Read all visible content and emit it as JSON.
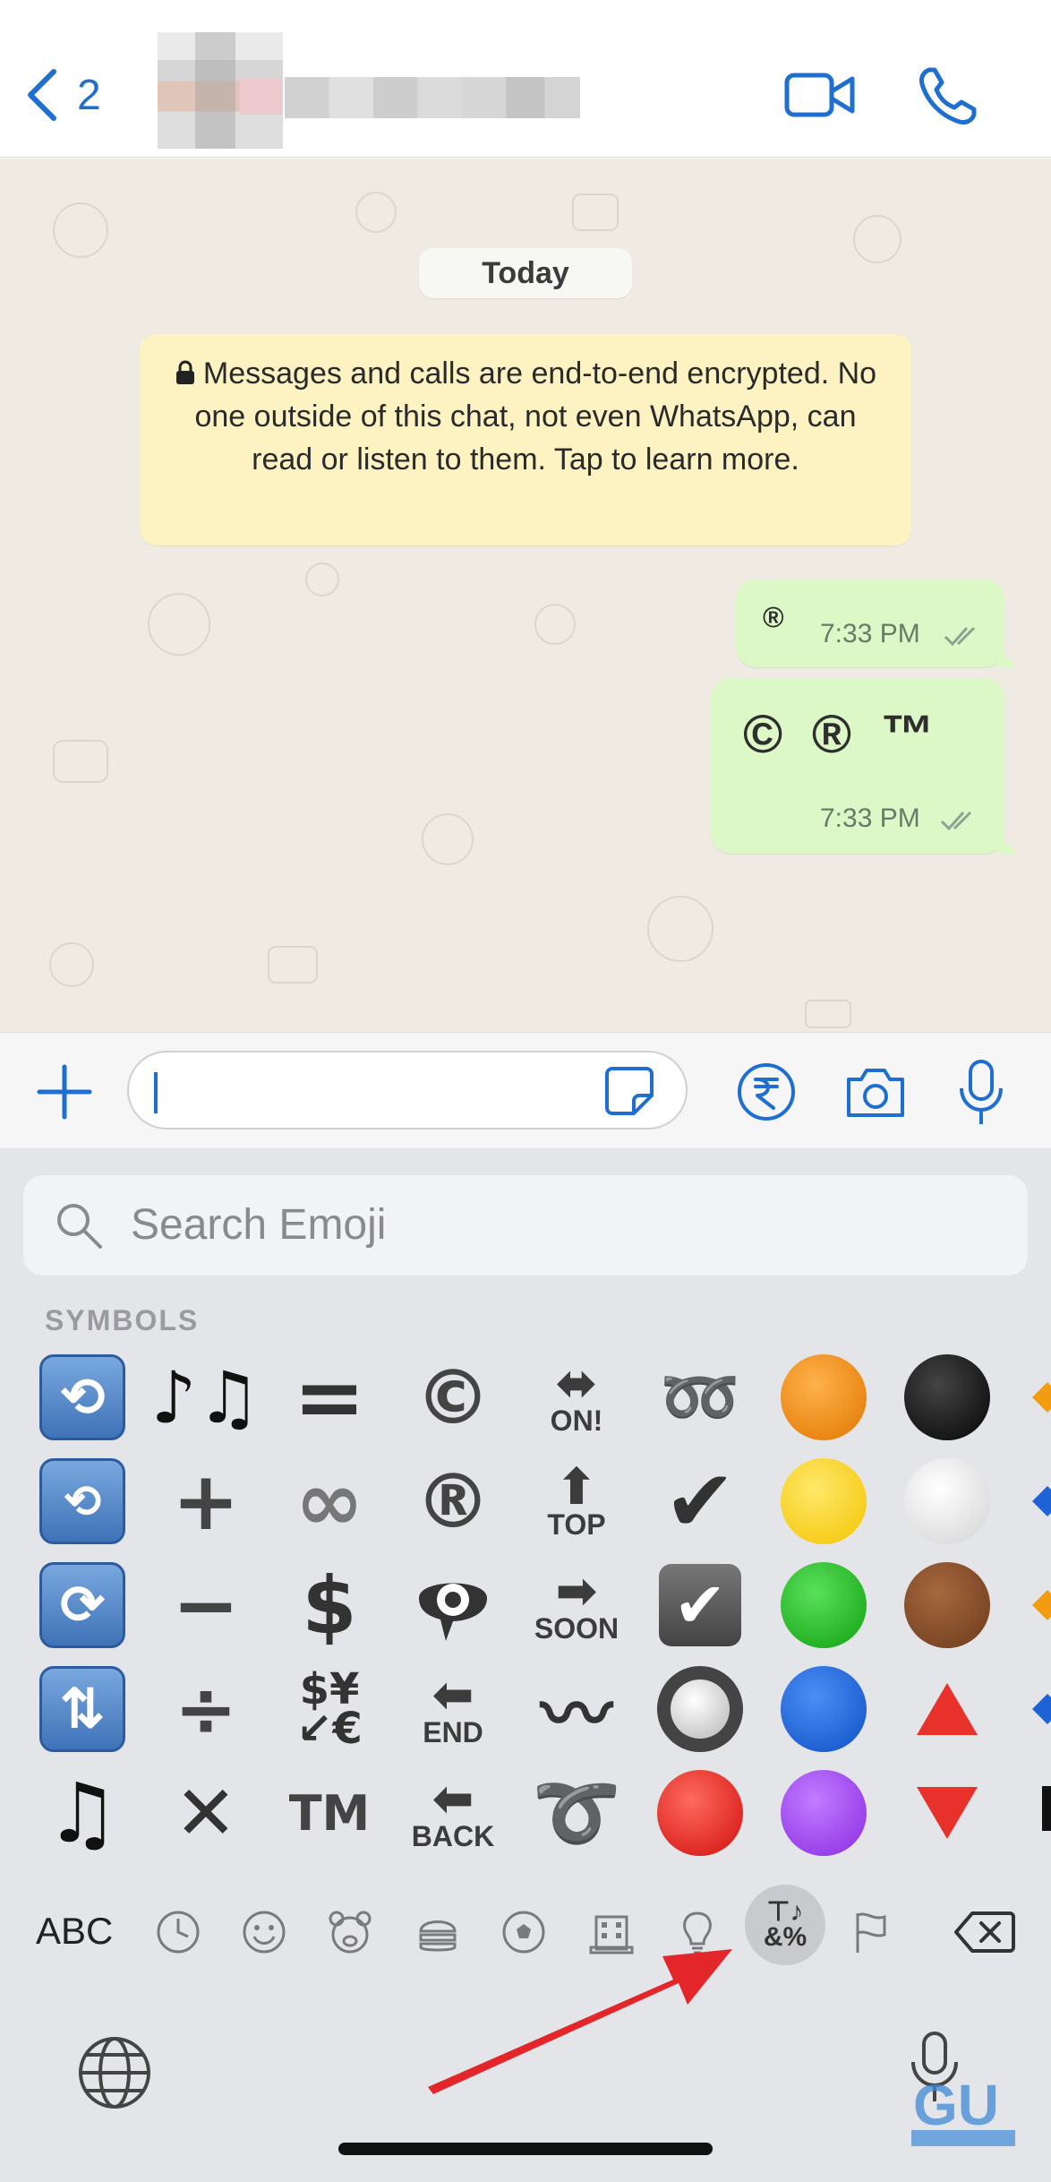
{
  "header": {
    "back_count": "2",
    "accent_color": "#1f6fd1"
  },
  "chat": {
    "date_label": "Today",
    "encryption_notice": "Messages and calls are end-to-end encrypted. No one outside of this chat, not even WhatsApp, can read or listen to them. Tap to learn more.",
    "messages": [
      {
        "text": "®",
        "time": "7:33 PM",
        "status": "read-ticks"
      },
      {
        "text": "© ® ™",
        "time": "7:33 PM",
        "status": "read-ticks"
      }
    ],
    "outgoing_bubble_color": "#dcf8c6",
    "notice_color": "#fdf3c2"
  },
  "input_bar": {
    "icons": [
      "plus-icon",
      "sticker-icon",
      "rupee-payment-icon",
      "camera-icon",
      "microphone-icon"
    ]
  },
  "keyboard": {
    "search_placeholder": "Search Emoji",
    "section_title": "SYMBOLS",
    "symbols": {
      "col1": [
        "🔁",
        "🔂",
        "🔄",
        "🔃",
        "🎵"
      ],
      "col2": [
        "🎶",
        "➕",
        "➖",
        "➗",
        "✖"
      ],
      "col3": [
        "🟰",
        "♾",
        "$",
        "💱",
        "™"
      ],
      "col4": [
        "©",
        "®",
        "👁‍🗨",
        "🔚",
        "🔙"
      ],
      "col5_labels": [
        "ON!",
        "TOP",
        "SOON",
        "END",
        "BACK"
      ],
      "col6": [
        "➿",
        "✔",
        "☑",
        "〰",
        "➰"
      ],
      "col7": [
        "🔘",
        "🔴"
      ],
      "circles": [
        "orange",
        "yellow",
        "green",
        "blue",
        "red",
        "purple",
        "black",
        "white",
        "brown"
      ],
      "triangles": [
        "red-up",
        "red-down"
      ]
    },
    "abc_label": "ABC",
    "categories": [
      "recent-clock-icon",
      "smiley-icon",
      "bear-icon",
      "food-icon",
      "soccer-ball-icon",
      "building-icon",
      "lightbulb-icon",
      "symbols-icon",
      "flag-icon"
    ],
    "selected_category_label_top": "⊤♪",
    "selected_category_label_bottom": "&%"
  },
  "annotation": {
    "arrow_color": "#e3262a"
  }
}
